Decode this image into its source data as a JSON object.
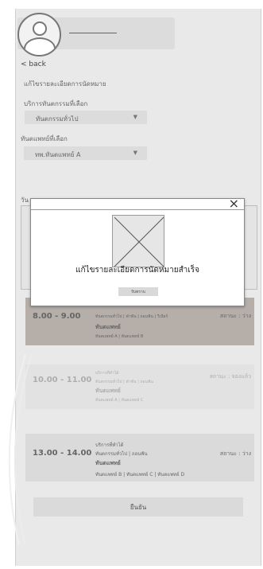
{
  "header": {
    "back_label": "< back"
  },
  "page": {
    "title": "แก้ไขรายละเอียดการนัดหมาย"
  },
  "form": {
    "activity_label": "บริการทันตกรรมที่เลือก",
    "activity_value": "ทันตกรรมทั่วไป",
    "dentist_label": "ทันตแพทย์ที่เลือก",
    "dentist_value": "ทพ.ทันตแพทย์ A",
    "date_label": "วัน"
  },
  "slots": [
    {
      "time": "8.00 - 9.00",
      "services": "ทันตกรรมทั่วไป | ฟ่าฟัน | ถอนฟัน | วีเนียร์",
      "dentist_label": "ทันตแพทย์",
      "dentists": "ทันตแพทย์ A | ทันตแพทย์ B",
      "status": "สถานะ : ว่าง"
    },
    {
      "time": "10.00 - 11.00",
      "services_label": "บริการที่ทำได้",
      "services": "ทันตกรรมทั่วไป | ฟ่าฟัน | ถอนฟัน",
      "dentist_label": "ทันตแพทย์",
      "dentists": "ทันตแพทย์ A | ทันตแพทย์ C",
      "status": "สถานะ : จองแล้ว"
    },
    {
      "time": "13.00 - 14.00",
      "services_label": "บริการที่ทำได้",
      "services": "ทันตกรรมทั่วไป | ถอนฟัน",
      "dentist_label": "ทันตแพทย์",
      "dentists": "ทันตแพทย์ B | ทันตแพทย์ C | ทันตแพทย์ D",
      "status": "สถานะ : ว่าง"
    }
  ],
  "confirm_label": "ยืนยัน",
  "modal": {
    "close_glyph": "×",
    "message": "แก้ไขรายละเอียดการนัดหมายสำเร็จ",
    "button_label": "รับทราบ"
  }
}
